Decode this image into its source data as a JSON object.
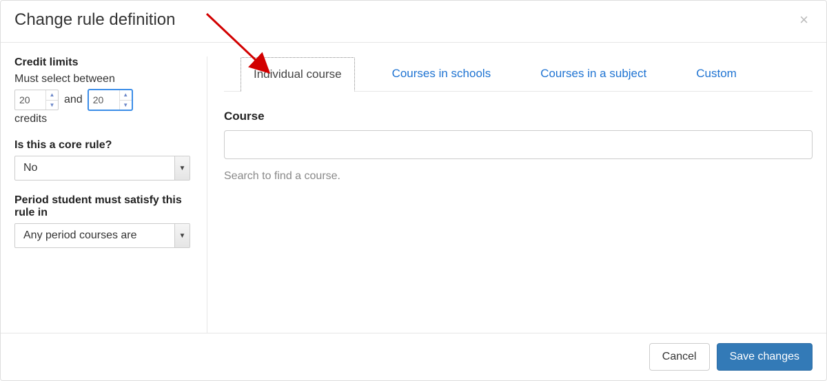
{
  "dialog": {
    "title": "Change rule definition"
  },
  "sidebar": {
    "credit_limits_label": "Credit limits",
    "must_select_label": "Must select between",
    "min_credits": "20",
    "and_text": "and",
    "max_credits": "20",
    "credits_suffix": "credits",
    "core_rule_label": "Is this a core rule?",
    "core_rule_value": "No",
    "period_label": "Period student must satisfy this rule in",
    "period_value": "Any period courses are"
  },
  "tabs": {
    "individual": "Individual course",
    "schools": "Courses in schools",
    "subject": "Courses in a subject",
    "custom": "Custom"
  },
  "course": {
    "label": "Course",
    "value": "",
    "hint": "Search to find a course."
  },
  "footer": {
    "cancel": "Cancel",
    "save": "Save changes"
  }
}
